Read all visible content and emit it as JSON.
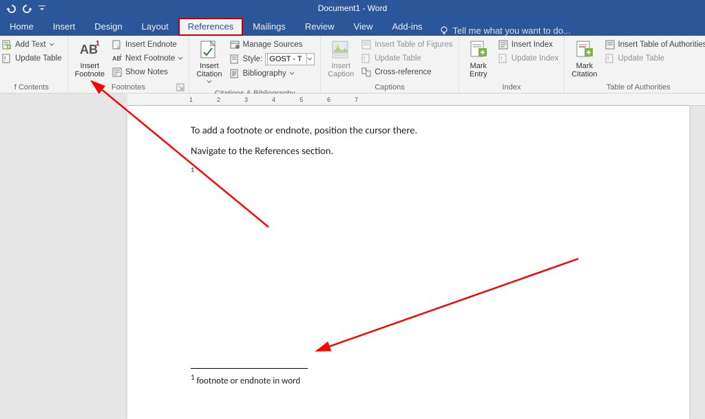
{
  "titlebar": {
    "title": "Document1 - Word"
  },
  "tabs": {
    "home": "Home",
    "insert": "Insert",
    "design": "Design",
    "layout": "Layout",
    "references": "References",
    "mailings": "Mailings",
    "review": "Review",
    "view": "View",
    "addins": "Add-ins",
    "tellme": "Tell me what you want to do..."
  },
  "ribbon": {
    "toc": {
      "label": "f Contents",
      "add_text": "Add Text",
      "update_table": "Update Table"
    },
    "footnotes": {
      "label": "Footnotes",
      "insert_footnote": "Insert Footnote",
      "insert_endnote": "Insert Endnote",
      "next_footnote": "Next Footnote",
      "show_notes": "Show Notes",
      "ab": "AB"
    },
    "citations": {
      "label": "Citations & Bibliography",
      "insert_citation": "Insert Citation",
      "manage_sources": "Manage Sources",
      "style_label": "Style:",
      "style_value": "GOST - T",
      "bibliography": "Bibliography"
    },
    "captions": {
      "label": "Captions",
      "insert_caption": "Insert Caption",
      "insert_tof": "Insert Table of Figures",
      "update_table": "Update Table",
      "cross_reference": "Cross-reference"
    },
    "index": {
      "label": "Index",
      "mark_entry": "Mark Entry",
      "insert_index": "Insert Index",
      "update_index": "Update Index"
    },
    "toa": {
      "label": "Table of Authorities",
      "mark_citation": "Mark Citation",
      "insert_toa": "Insert Table of Authorities",
      "update_table": "Update Table"
    }
  },
  "document": {
    "line1": "To add a footnote or endnote, position the cursor there.",
    "line2": "Navigate to the References section.",
    "refmark": "1",
    "footnote_num": "1",
    "footnote_text": " footnote or endnote in word"
  },
  "ruler": {
    "marks": [
      "1",
      "2",
      "3",
      "4",
      "5",
      "6",
      "7"
    ]
  }
}
